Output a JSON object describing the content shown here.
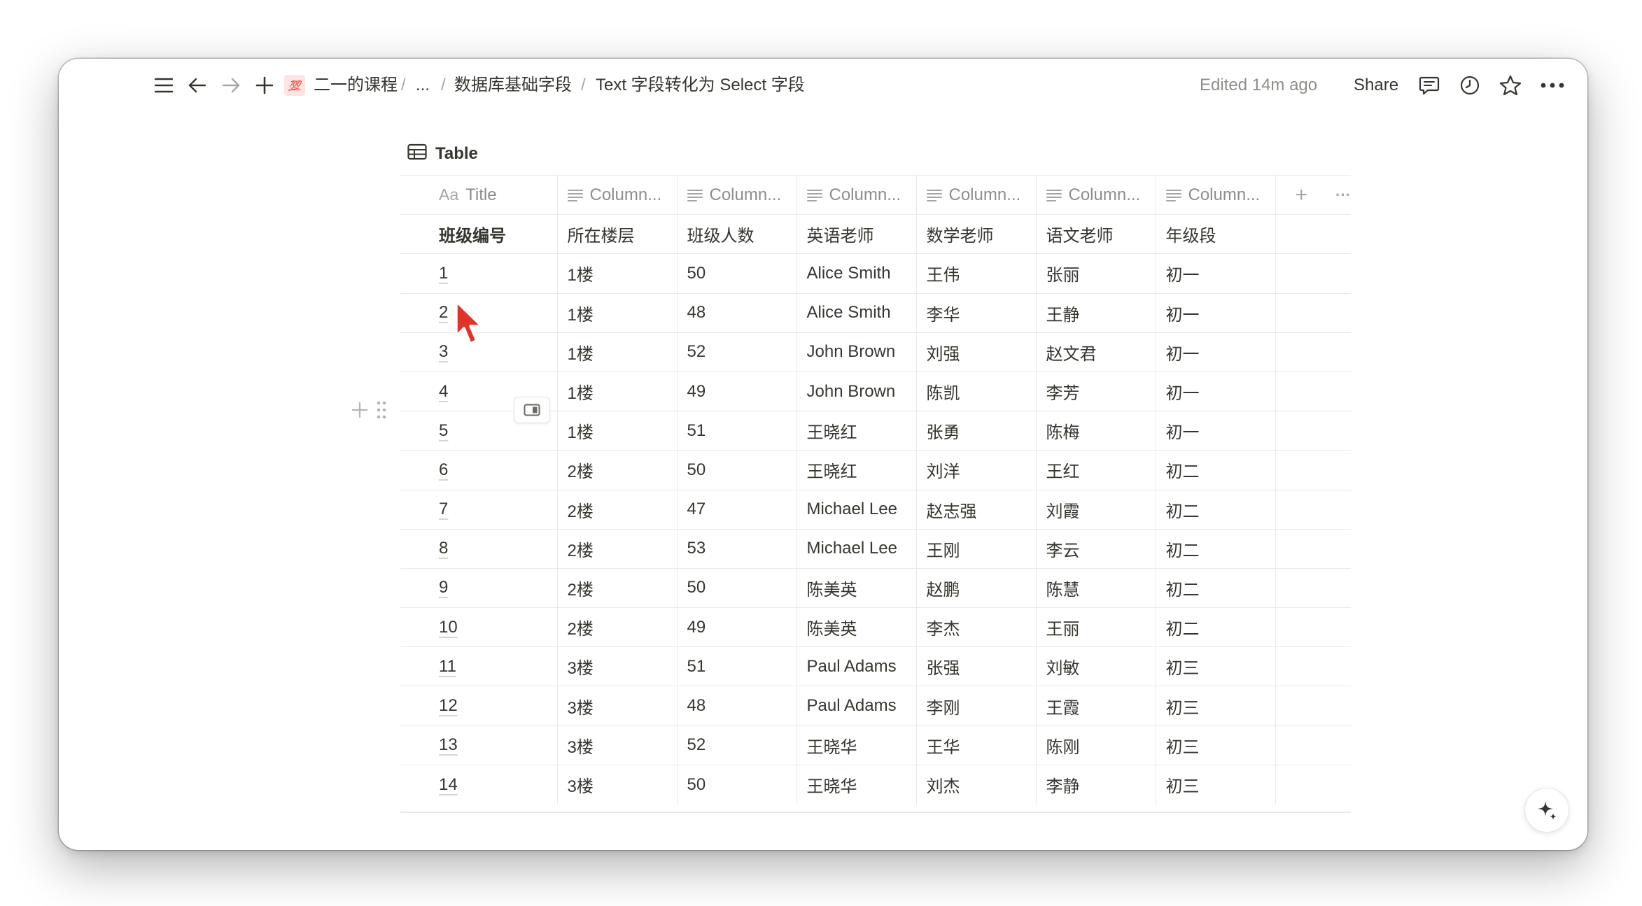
{
  "breadcrumb": {
    "emoji": "💯",
    "root": "二一的课程",
    "sep": "/",
    "ellipsis": "...",
    "parent": "数据库基础字段",
    "current": "Text 字段转化为 Select 字段"
  },
  "topbar": {
    "edited": "Edited 14m ago",
    "share": "Share"
  },
  "view": {
    "title": "Table"
  },
  "columns": {
    "title_prefix": "Aa",
    "title": "Title",
    "names": [
      "Column...",
      "Column...",
      "Column...",
      "Column...",
      "Column...",
      "Column..."
    ],
    "add": "+",
    "more": "···"
  },
  "header_row": [
    "班级编号",
    "所在楼层",
    "班级人数",
    "英语老师",
    "数学老师",
    "语文老师",
    "年级段"
  ],
  "rows": [
    [
      "1",
      "1楼",
      "50",
      "Alice Smith",
      "王伟",
      "张丽",
      "初一"
    ],
    [
      "2",
      "1楼",
      "48",
      "Alice Smith",
      "李华",
      "王静",
      "初一"
    ],
    [
      "3",
      "1楼",
      "52",
      "John Brown",
      "刘强",
      "赵文君",
      "初一"
    ],
    [
      "4",
      "1楼",
      "49",
      "John Brown",
      "陈凯",
      "李芳",
      "初一"
    ],
    [
      "5",
      "1楼",
      "51",
      "王晓红",
      "张勇",
      "陈梅",
      "初一"
    ],
    [
      "6",
      "2楼",
      "50",
      "王晓红",
      "刘洋",
      "王红",
      "初二"
    ],
    [
      "7",
      "2楼",
      "47",
      "Michael Lee",
      "赵志强",
      "刘霞",
      "初二"
    ],
    [
      "8",
      "2楼",
      "53",
      "Michael Lee",
      "王刚",
      "李云",
      "初二"
    ],
    [
      "9",
      "2楼",
      "50",
      "陈美英",
      "赵鹏",
      "陈慧",
      "初二"
    ],
    [
      "10",
      "2楼",
      "49",
      "陈美英",
      "李杰",
      "王丽",
      "初二"
    ],
    [
      "11",
      "3楼",
      "51",
      "Paul Adams",
      "张强",
      "刘敏",
      "初三"
    ],
    [
      "12",
      "3楼",
      "48",
      "Paul Adams",
      "李刚",
      "王霞",
      "初三"
    ],
    [
      "13",
      "3楼",
      "52",
      "王晓华",
      "王华",
      "陈刚",
      "初三"
    ],
    [
      "14",
      "3楼",
      "50",
      "王晓华",
      "刘杰",
      "李静",
      "初三"
    ]
  ],
  "icons": {
    "menu": "hamburger-icon",
    "back": "arrow-left-icon",
    "forward": "arrow-right-icon",
    "new": "plus-icon",
    "comments": "comment-icon",
    "updates": "clock-icon",
    "favorite": "star-icon",
    "more": "more-horizontal-icon",
    "table": "table-icon",
    "text_prop": "text-lines-icon",
    "ai": "sparkle-icon",
    "cursor": "pointer-cursor-icon"
  },
  "colors": {
    "text": "#37352f",
    "muted": "#8f8d89",
    "border": "#e9e9e7",
    "emoji_bg": "#fde5e3",
    "cursor": "#e0342a"
  }
}
